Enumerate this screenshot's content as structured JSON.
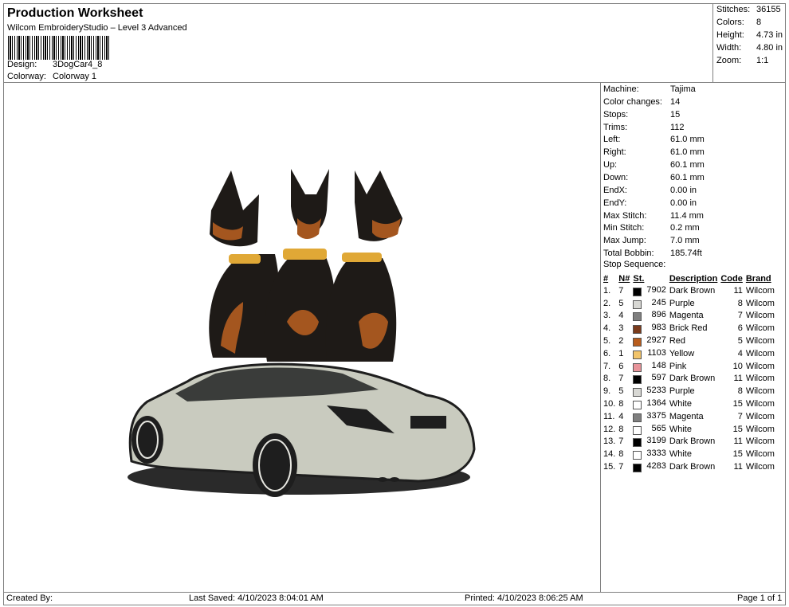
{
  "header": {
    "title": "Production Worksheet",
    "subtitle": "Wilcom EmbroideryStudio – Level 3 Advanced",
    "design_label": "Design:",
    "design_value": "3DogCar4_8",
    "colorway_label": "Colorway:",
    "colorway_value": "Colorway 1"
  },
  "stats": [
    {
      "label": "Stitches:",
      "value": "36155"
    },
    {
      "label": "Colors:",
      "value": "8"
    },
    {
      "label": "Height:",
      "value": "4.73 in"
    },
    {
      "label": "Width:",
      "value": "4.80 in"
    },
    {
      "label": "Zoom:",
      "value": "1:1"
    }
  ],
  "machine_info": [
    {
      "label": "Machine:",
      "value": "Tajima"
    },
    {
      "label": "Color changes:",
      "value": "14"
    },
    {
      "label": "Stops:",
      "value": "15"
    },
    {
      "label": "Trims:",
      "value": "112"
    },
    {
      "label": "Left:",
      "value": "61.0 mm"
    },
    {
      "label": "Right:",
      "value": "61.0 mm"
    },
    {
      "label": "Up:",
      "value": "60.1 mm"
    },
    {
      "label": "Down:",
      "value": "60.1 mm"
    },
    {
      "label": "EndX:",
      "value": "0.00 in"
    },
    {
      "label": "EndY:",
      "value": "0.00 in"
    },
    {
      "label": "Max Stitch:",
      "value": "11.4 mm"
    },
    {
      "label": "Min Stitch:",
      "value": "0.2 mm"
    },
    {
      "label": "Max Jump:",
      "value": "7.0 mm"
    },
    {
      "label": "Total Bobbin:",
      "value": "185.74ft"
    }
  ],
  "stop_sequence": {
    "title": "Stop Sequence:",
    "headers": [
      "#",
      "N#",
      "St.",
      "Description",
      "Code",
      "Brand"
    ],
    "rows": [
      {
        "idx": "1.",
        "n": "7",
        "color": "#000000",
        "st": "7902",
        "desc": "Dark Brown",
        "code": "11",
        "brand": "Wilcom"
      },
      {
        "idx": "2.",
        "n": "5",
        "color": "#d8d8d4",
        "st": "245",
        "desc": "Purple",
        "code": "8",
        "brand": "Wilcom"
      },
      {
        "idx": "3.",
        "n": "4",
        "color": "#7f7f7f",
        "st": "896",
        "desc": "Magenta",
        "code": "7",
        "brand": "Wilcom"
      },
      {
        "idx": "4.",
        "n": "3",
        "color": "#7a3b1c",
        "st": "983",
        "desc": "Brick Red",
        "code": "6",
        "brand": "Wilcom"
      },
      {
        "idx": "5.",
        "n": "2",
        "color": "#b85c1c",
        "st": "2927",
        "desc": "Red",
        "code": "5",
        "brand": "Wilcom"
      },
      {
        "idx": "6.",
        "n": "1",
        "color": "#f2c46a",
        "st": "1103",
        "desc": "Yellow",
        "code": "4",
        "brand": "Wilcom"
      },
      {
        "idx": "7.",
        "n": "6",
        "color": "#e8949a",
        "st": "148",
        "desc": "Pink",
        "code": "10",
        "brand": "Wilcom"
      },
      {
        "idx": "8.",
        "n": "7",
        "color": "#000000",
        "st": "597",
        "desc": "Dark Brown",
        "code": "11",
        "brand": "Wilcom"
      },
      {
        "idx": "9.",
        "n": "5",
        "color": "#d8d8d4",
        "st": "5233",
        "desc": "Purple",
        "code": "8",
        "brand": "Wilcom"
      },
      {
        "idx": "10.",
        "n": "8",
        "color": "#ffffff",
        "st": "1364",
        "desc": "White",
        "code": "15",
        "brand": "Wilcom"
      },
      {
        "idx": "11.",
        "n": "4",
        "color": "#7f7f7f",
        "st": "3375",
        "desc": "Magenta",
        "code": "7",
        "brand": "Wilcom"
      },
      {
        "idx": "12.",
        "n": "8",
        "color": "#ffffff",
        "st": "565",
        "desc": "White",
        "code": "15",
        "brand": "Wilcom"
      },
      {
        "idx": "13.",
        "n": "7",
        "color": "#000000",
        "st": "3199",
        "desc": "Dark Brown",
        "code": "11",
        "brand": "Wilcom"
      },
      {
        "idx": "14.",
        "n": "8",
        "color": "#ffffff",
        "st": "3333",
        "desc": "White",
        "code": "15",
        "brand": "Wilcom"
      },
      {
        "idx": "15.",
        "n": "7",
        "color": "#000000",
        "st": "4283",
        "desc": "Dark Brown",
        "code": "11",
        "brand": "Wilcom"
      }
    ]
  },
  "footer": {
    "created_by": "Created By:",
    "last_saved": "Last Saved: 4/10/2023 8:04:01 AM",
    "printed": "Printed: 4/10/2023 8:06:25 AM",
    "page": "Page 1 of 1"
  }
}
